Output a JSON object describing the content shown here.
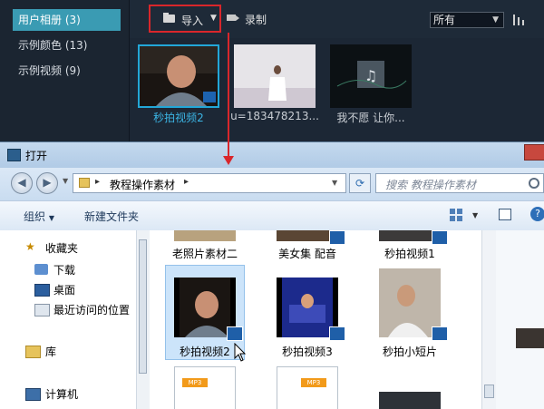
{
  "library": {
    "sidebar": [
      {
        "label": "用户相册 (3)",
        "active": true
      },
      {
        "label": "示例颜色 (13)",
        "active": false
      },
      {
        "label": "示例视频 (9)",
        "active": false
      }
    ],
    "toolbar": {
      "import_label": "导入",
      "record_label": "录制",
      "sort_value": "所有"
    },
    "thumbnails": [
      {
        "caption": "秒拍视频2",
        "selected": true
      },
      {
        "caption": "u=183478213...",
        "selected": false
      },
      {
        "caption": "我不愿 让你...",
        "selected": false
      }
    ]
  },
  "dialog": {
    "title": "打开",
    "address": {
      "path": "教程操作素材",
      "separator": "▸"
    },
    "search_placeholder": "搜索 教程操作素材",
    "toolbar": {
      "organize_label": "组织",
      "new_folder_label": "新建文件夹"
    },
    "nav": {
      "favorites": "收藏夹",
      "downloads": "下载",
      "desktop": "桌面",
      "recent": "最近访问的位置",
      "libraries": "库",
      "computer": "计算机"
    },
    "files_row1": [
      "老照片素材二",
      "美女集  配音",
      "秒拍视频1"
    ],
    "files_row2": [
      "秒拍视频2",
      "秒拍视频3",
      "秒拍小短片"
    ],
    "files_row3_badges": [
      "MP3",
      "MP3"
    ]
  },
  "colors": {
    "accent": "#3a9bb3",
    "highlight_red": "#d9262b",
    "selection": "#cce4fa"
  }
}
